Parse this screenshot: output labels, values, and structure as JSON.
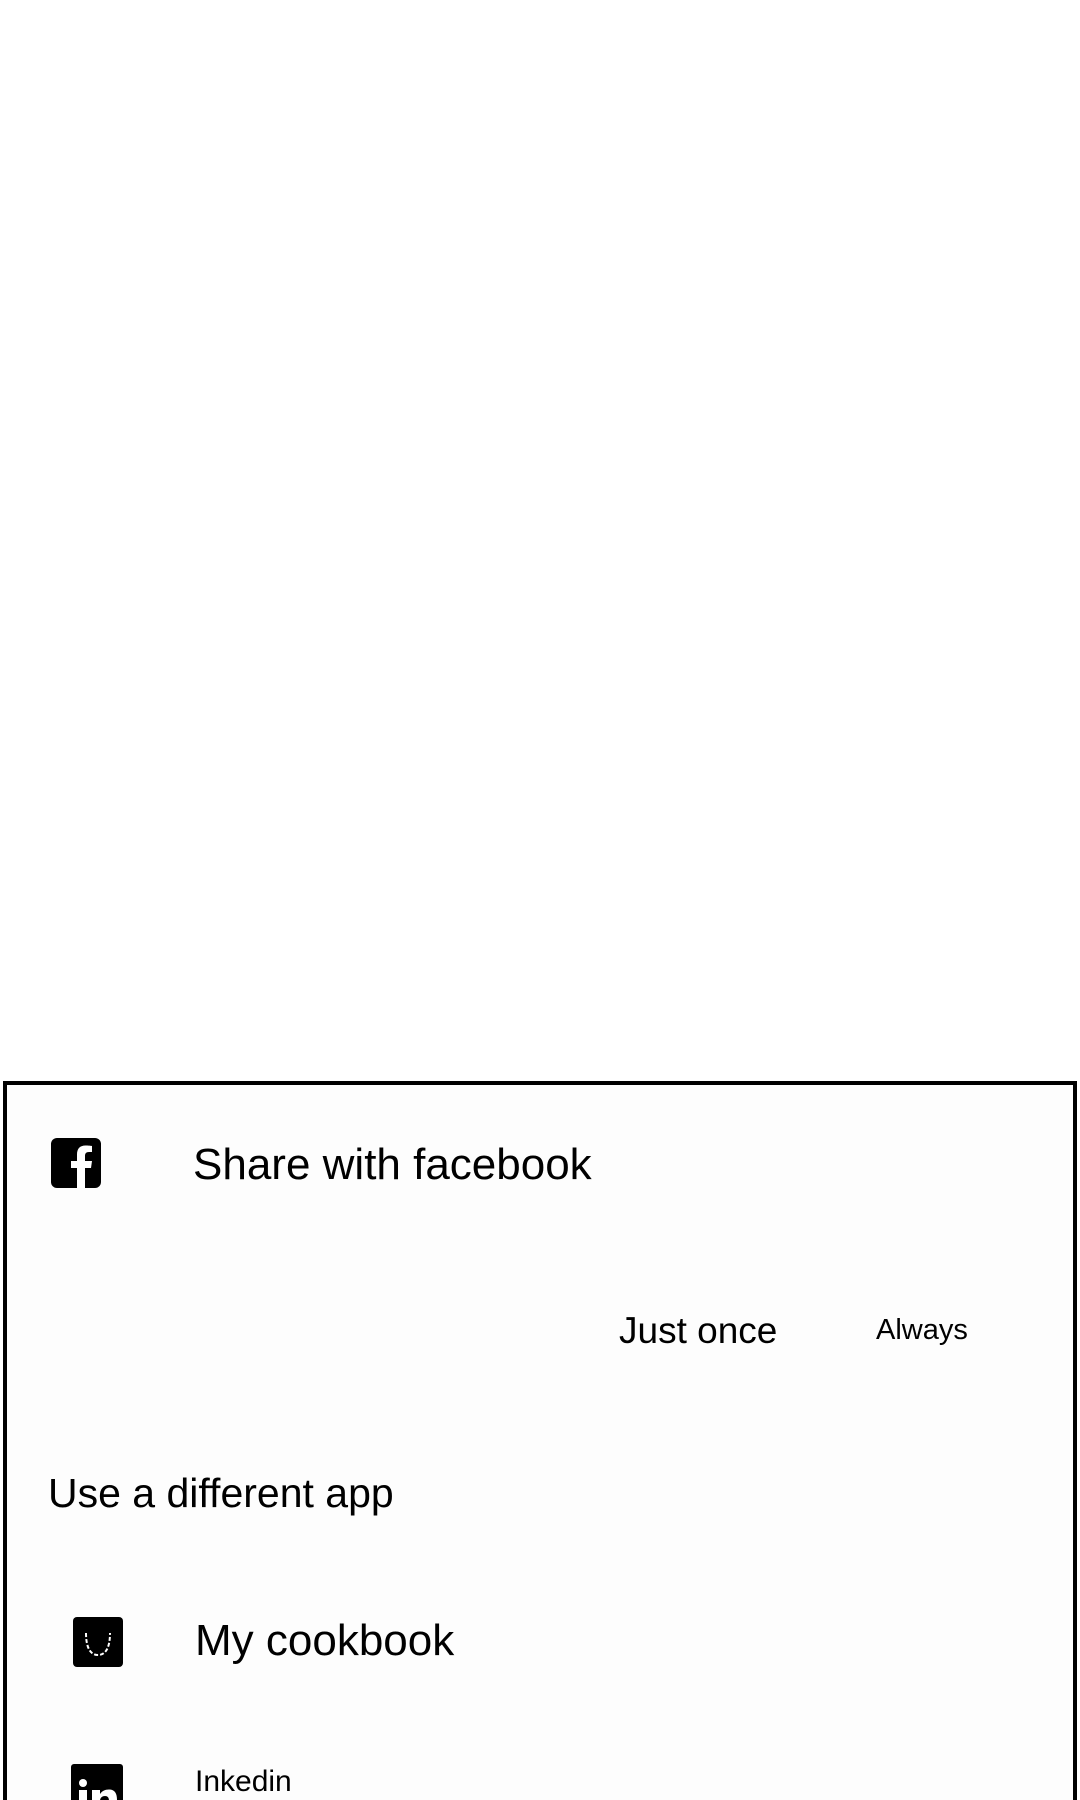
{
  "chooser": {
    "primary": {
      "label": "Share with facebook",
      "icon": "facebook-icon"
    },
    "actions": {
      "just_once": "Just once",
      "always": "Always"
    },
    "other_section_title": "Use a different app",
    "apps": [
      {
        "label": "My cookbook",
        "icon": "cookbook-icon"
      },
      {
        "label": "Inkedin",
        "icon": "linkedin-icon"
      }
    ]
  },
  "colors": {
    "sheet_background": "#fdfdfd",
    "border": "#000000",
    "text": "#000000",
    "page_background": "#ffffff"
  }
}
